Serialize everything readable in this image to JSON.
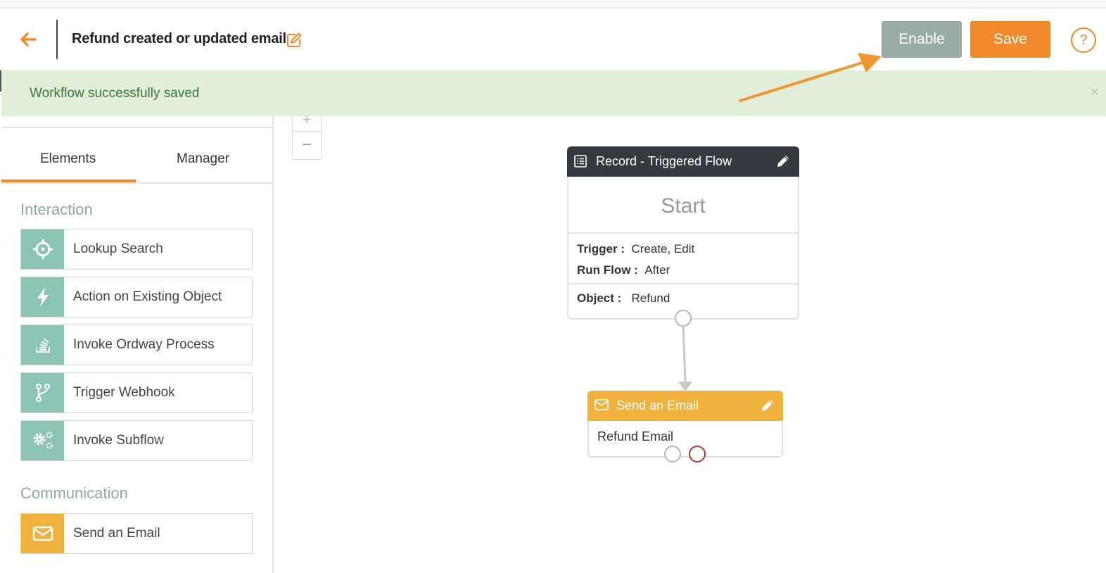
{
  "header": {
    "title": "Refund created or updated email",
    "enable_label": "Enable",
    "save_label": "Save",
    "help_label": "?"
  },
  "banner": {
    "message": "Workflow successfully saved",
    "close_label": "×"
  },
  "sidebar": {
    "tabs": [
      {
        "label": "Elements",
        "active": true
      },
      {
        "label": "Manager",
        "active": false
      }
    ],
    "sections": [
      {
        "title": "Interaction",
        "items": [
          {
            "label": "Lookup Search",
            "icon": "crosshair-icon"
          },
          {
            "label": "Action on Existing Object",
            "icon": "lightning-icon"
          },
          {
            "label": "Invoke Ordway Process",
            "icon": "stack-icon"
          },
          {
            "label": "Trigger Webhook",
            "icon": "branch-icon"
          },
          {
            "label": "Invoke Subflow",
            "icon": "gears-icon"
          }
        ]
      },
      {
        "title": "Communication",
        "items": [
          {
            "label": "Send an Email",
            "icon": "envelope-icon"
          }
        ]
      }
    ]
  },
  "canvas": {
    "zoom_in_label": "+",
    "zoom_out_label": "−",
    "start_node": {
      "header": "Record - Triggered Flow",
      "title": "Start",
      "trigger_label": "Trigger :",
      "trigger_value": "Create, Edit",
      "run_flow_label": "Run Flow :",
      "run_flow_value": "After",
      "object_label": "Object :",
      "object_value": "Refund"
    },
    "email_node": {
      "header": "Send an Email",
      "body": "Refund Email"
    }
  },
  "colors": {
    "accent": "#f0882c",
    "enable_button": "#9aaca6",
    "success_banner": "#e1efd9",
    "success_text": "#3c763d",
    "element_icon_bg": "#8bc3b5",
    "email_color": "#f0b13e",
    "start_header": "#343a40"
  }
}
